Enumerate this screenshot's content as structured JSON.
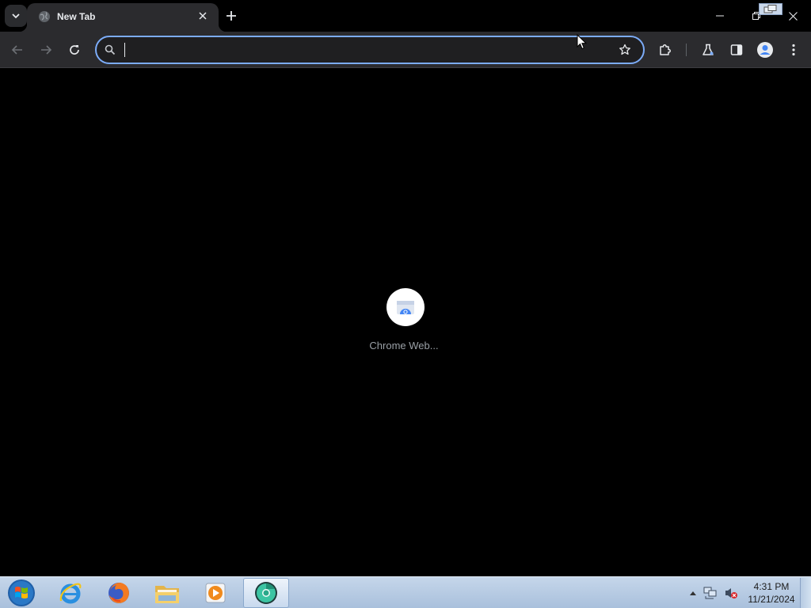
{
  "browser": {
    "tab": {
      "title": "New Tab"
    },
    "omnibox": {
      "value": "",
      "placeholder": ""
    },
    "accent_color": "#7cacf8"
  },
  "content": {
    "loading_label": "Chrome Web..."
  },
  "taskbar": {
    "apps": [
      {
        "name": "internet-explorer-icon"
      },
      {
        "name": "firefox-icon"
      },
      {
        "name": "file-explorer-icon"
      },
      {
        "name": "media-player-icon"
      },
      {
        "name": "chrome-canary-icon",
        "active": true
      }
    ],
    "clock": {
      "time": "4:31 PM",
      "date": "11/21/2024"
    }
  }
}
